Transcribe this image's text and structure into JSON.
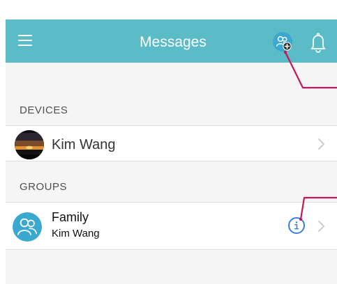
{
  "header": {
    "title": "Messages",
    "menu_icon": "hamburger-menu-icon",
    "group_add_icon": "group-add-icon",
    "notification_icon": "bell-icon",
    "bar_color": "#5bbcc8",
    "accent_color": "#3aa8cf"
  },
  "sections": {
    "devices": {
      "label": "DEVICES",
      "items": [
        {
          "name": "Kim Wang",
          "avatar": "sunset-photo-avatar",
          "disclosure_icon": "chevron-right-icon"
        }
      ]
    },
    "groups": {
      "label": "GROUPS",
      "items": [
        {
          "name": "Family",
          "subtitle": "Kim Wang",
          "avatar": "group-icon",
          "info_icon": "info-icon",
          "disclosure_icon": "chevron-right-icon"
        }
      ]
    }
  },
  "annotations": {
    "callout_color": "#c2185b"
  }
}
